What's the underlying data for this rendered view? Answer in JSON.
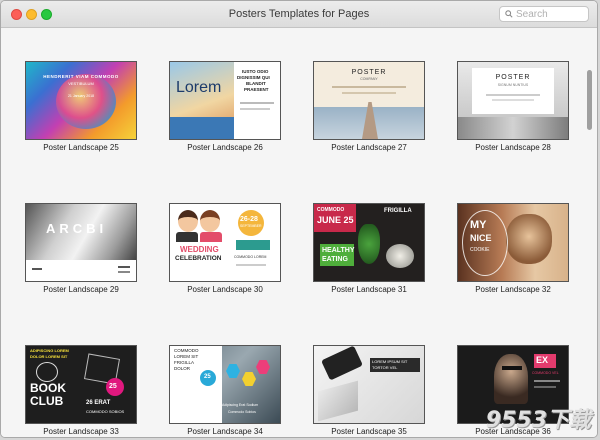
{
  "window": {
    "title": "Posters Templates for Pages"
  },
  "search": {
    "placeholder": "Search"
  },
  "templates": [
    {
      "label": "Poster Landscape 25",
      "t1": "HENDRERIT VIAM COMMODO",
      "t2": "VESTIBULUM",
      "t3": "21 January 2018"
    },
    {
      "label": "Poster Landscape 26",
      "t1": "Lorem",
      "t2": "IUSTO ODIO",
      "t3": "DIGNISSIM QUI",
      "t4": "BLANDIT",
      "t5": "PRAESENT"
    },
    {
      "label": "Poster Landscape 27",
      "t1": "POSTER",
      "t2": "COMPANY"
    },
    {
      "label": "Poster Landscape 28",
      "t1": "POSTER",
      "t2": "SIGNUM NUNTIUS"
    },
    {
      "label": "Poster Landscape 29",
      "t1": "ARCBI"
    },
    {
      "label": "Poster Landscape 30",
      "t1": "26-28",
      "t2": "SEPTEMBER",
      "t3": "WEDDING",
      "t4": "CELEBRATION",
      "t5": "COMMODO LOREM"
    },
    {
      "label": "Poster Landscape 31",
      "t1": "COMMODO",
      "t2": "JUNE 25",
      "t3": "FRIGILLA",
      "t4": "HEALTHY",
      "t5": "EATING"
    },
    {
      "label": "Poster Landscape 32",
      "t1": "MY",
      "t2": "NICE",
      "t3": "COOKIE"
    },
    {
      "label": "Poster Landscape 33",
      "t1": "ADIPISCING LOREM",
      "t2": "DOLOR LOREM SIT",
      "t3": "BOOK",
      "t4": "CLUB",
      "t5": "25",
      "t6": "26 ERAT",
      "t7": "COMMODO SOBIOS"
    },
    {
      "label": "Poster Landscape 34",
      "t1": "COMMODO",
      "t2": "LOREM SIT",
      "t3": "FRIGILLA",
      "t4": "DOLOR",
      "t5": "25",
      "t6": "Adipiscing Erat Sodium",
      "t7": "Commodo Sobios"
    },
    {
      "label": "Poster Landscape 35",
      "t1": "LOREM IPSUM SIT",
      "t2": "TORTOR VEL"
    },
    {
      "label": "Poster Landscape 36",
      "t1": "EX",
      "t2": "COMMODO VEL"
    }
  ],
  "watermark": "9553下载"
}
